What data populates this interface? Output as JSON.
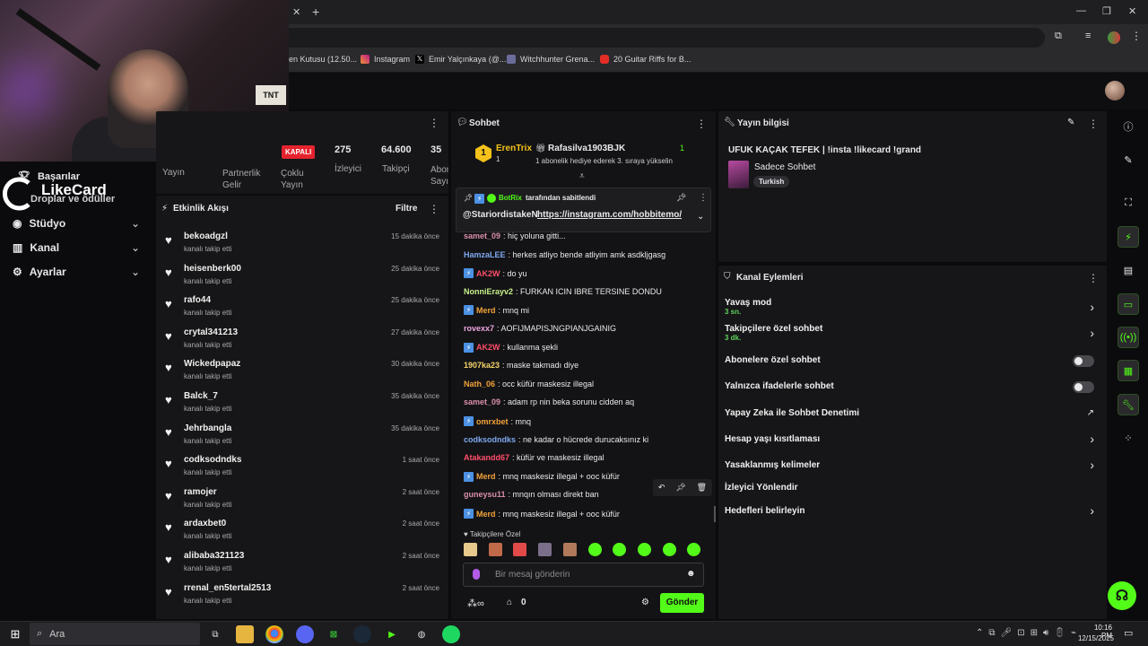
{
  "browser": {
    "bookmarks": [
      {
        "label": "len Kutusu (12.50...",
        "icon": "mail-icon"
      },
      {
        "label": "Instagram",
        "icon": "instagram-icon"
      },
      {
        "label": "Emir Yalçınkaya (@...",
        "icon": "x-icon"
      },
      {
        "label": "Witchhunter Grena...",
        "icon": "shield-icon"
      },
      {
        "label": "20 Guitar Riffs for B...",
        "icon": "youtube-icon"
      }
    ]
  },
  "webcam": {
    "sign": "TNT"
  },
  "nav": {
    "top_item": "Başarılar",
    "top_item_sub": "Droplar ve ödüller",
    "likecard": "LikeCard",
    "studio": "Stüdyo",
    "channel": "Kanal",
    "settings": "Ayarlar"
  },
  "stats": {
    "status": "KAPALI",
    "tabs": [
      "Yayın",
      "Partnerlik Gelir",
      "Çoklu Yayın"
    ],
    "viewers_value": "275",
    "viewers_label": "İzleyici",
    "followers_value": "64.600",
    "followers_label": "Takipçi",
    "subs_value": "35",
    "subs_label": "Abone Sayısı"
  },
  "activity": {
    "title": "Etkinlik Akışı",
    "filter": "Filtre",
    "items": [
      {
        "name": "bekoadgzl",
        "sub": "kanalı takip etti",
        "time": "15 dakika önce"
      },
      {
        "name": "heisenberk00",
        "sub": "kanalı takip etti",
        "time": "25 dakika önce"
      },
      {
        "name": "rafo44",
        "sub": "kanalı takip etti",
        "time": "25 dakika önce"
      },
      {
        "name": "crytal341213",
        "sub": "kanalı takip etti",
        "time": "27 dakika önce"
      },
      {
        "name": "Wickedpapaz",
        "sub": "kanalı takip etti",
        "time": "30 dakika önce"
      },
      {
        "name": "Balck_7",
        "sub": "kanalı takip etti",
        "time": "35 dakika önce"
      },
      {
        "name": "Jehrbangla",
        "sub": "kanalı takip etti",
        "time": "35 dakika önce"
      },
      {
        "name": "codksodndks",
        "sub": "kanalı takip etti",
        "time": "1 saat önce"
      },
      {
        "name": "ramojer",
        "sub": "kanalı takip etti",
        "time": "2 saat önce"
      },
      {
        "name": "ardaxbet0",
        "sub": "kanalı takip etti",
        "time": "2 saat önce"
      },
      {
        "name": "alibaba321123",
        "sub": "kanalı takip etti",
        "time": "2 saat önce"
      },
      {
        "name": "rrenal_en5tertal2513",
        "sub": "kanalı takip etti",
        "time": "2 saat önce"
      }
    ]
  },
  "chat": {
    "title": "Sohbet",
    "gift_leader": "ErenTrix",
    "gift_leader_count": "1",
    "gift_rank": "1",
    "gifter": "Rafasilva1903BJK",
    "gifter_count": "1",
    "gift_text": "1 abonelik hediye ederek 3. sıraya yükselin",
    "pinned_by": "BotRix",
    "pinned_suffix": "tarafından sabitlendi",
    "pinned_user": "@StariordistakeN",
    "pinned_link": "https://instagram.com/hobbitemo/",
    "messages": [
      {
        "user": "samet_09",
        "text": ": hiç yoluna gitti...",
        "color": "#d98fa8",
        "mod": false
      },
      {
        "user": "HamzaLEE",
        "text": ": herkes atliyo bende atliyim amk asdkljgasg",
        "color": "#7fa8f0",
        "mod": false
      },
      {
        "user": "AK2W",
        "text": ": do yu",
        "color": "#ff4d6a",
        "mod": true
      },
      {
        "user": "NonniErayv2",
        "text": ": FURKAN ICIN IBRE TERSINE DONDU",
        "color": "#c7f08a",
        "mod": false
      },
      {
        "user": "Merd",
        "text": ": mnq mi",
        "color": "#f2a23a",
        "mod": true
      },
      {
        "user": "rovexx7",
        "text": ": AOFIJMAPISJNGPIANJGAINIG",
        "color": "#f0a6e0",
        "mod": false
      },
      {
        "user": "AK2W",
        "text": ": kullanma şekli",
        "color": "#ff4d6a",
        "mod": true
      },
      {
        "user": "1907ka23",
        "text": ": maske takmadı diye",
        "color": "#f5d36a",
        "mod": false
      },
      {
        "user": "Nath_06",
        "text": ": occ küfür maskesiz illegal",
        "color": "#f2a23a",
        "mod": false
      },
      {
        "user": "samet_09",
        "text": ": adam rp nin beka sorunu cidden aq",
        "color": "#d98fa8",
        "mod": false
      },
      {
        "user": "omrxbet",
        "text": ": mnq",
        "color": "#f2a23a",
        "mod": true
      },
      {
        "user": "codksodndks",
        "text": ": ne kadar o hücrede durucaksınız ki",
        "color": "#7fa8f0",
        "mod": false
      },
      {
        "user": "Atakandd67",
        "text": ": küfür ve maskesiz illegal",
        "color": "#ff4d6a",
        "mod": false
      },
      {
        "user": "Merd",
        "text": ": mnq maskesiz illegal + ooc küfür",
        "color": "#f2a23a",
        "mod": true
      },
      {
        "user": "guneysu11",
        "text": ": mnqın olması direkt ban",
        "color": "#d98fa8",
        "mod": false
      },
      {
        "user": "Merd",
        "text": ": mnq maskesiz illegal + ooc küfür",
        "color": "#f2a23a",
        "mod": true
      }
    ],
    "followers_only": "Takipçilere Özel",
    "input_placeholder": "Bir mesaj gönderin",
    "points": "0",
    "send": "Gönder"
  },
  "info": {
    "title": "Yayın bilgisi",
    "stream_title": "UFUK KAÇAK TEFEK | !insta !likecard !grand",
    "category": "Sadece Sohbet",
    "language": "Turkish"
  },
  "actions": {
    "title": "Kanal Eylemleri",
    "slow_mode": "Yavaş mod",
    "slow_mode_value": "3 sn.",
    "followers_chat": "Takipçilere özel sohbet",
    "followers_chat_value": "3 dk.",
    "subs_chat": "Abonelere özel sohbet",
    "emote_chat": "Yalnızca ifadelerle sohbet",
    "ai_mod": "Yapay Zeka ile Sohbet Denetimi",
    "age_restrict": "Hesap yaşı kısıtlaması",
    "banned_words": "Yasaklanmış kelimeler",
    "redirect": "İzleyici Yönlendir",
    "goals": "Hedefleri belirleyin"
  },
  "taskbar": {
    "search": "Ara",
    "time": "10:16 PM",
    "date": "12/15/2025"
  },
  "colors": {
    "accent": "#53fc18",
    "panel": "#161618",
    "mod": "#4b90e2"
  }
}
